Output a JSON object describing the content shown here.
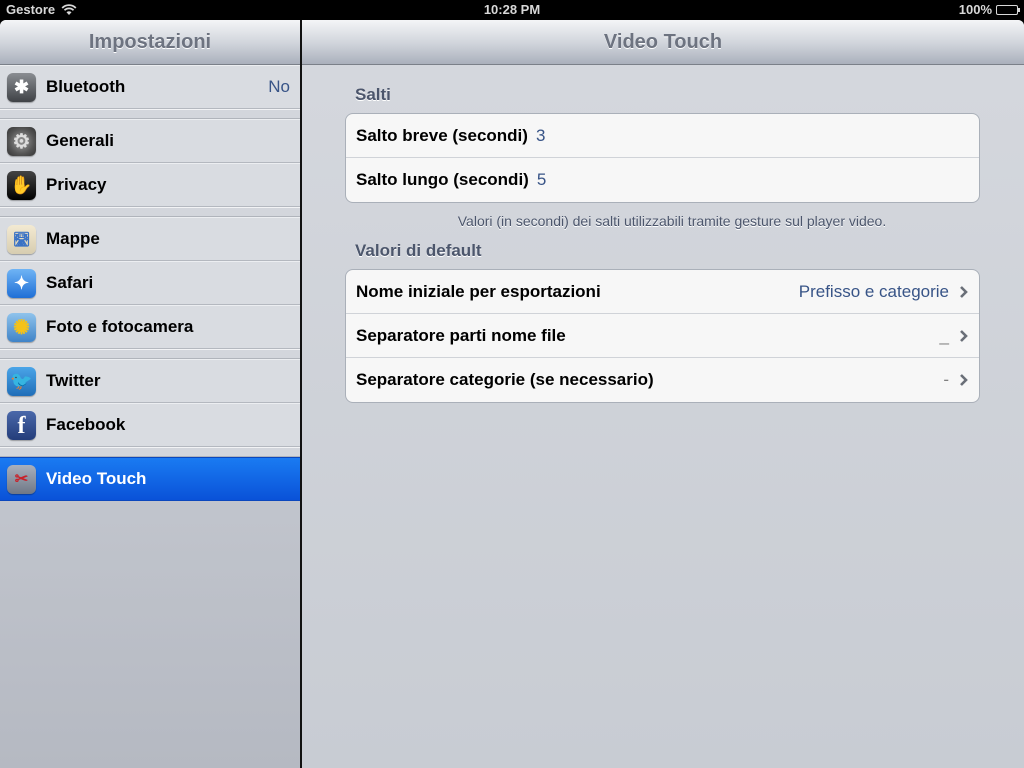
{
  "status_bar": {
    "carrier": "Gestore",
    "time": "10:28 PM",
    "battery": "100%"
  },
  "sidebar": {
    "title": "Impostazioni",
    "groups": [
      [
        {
          "label": "Bluetooth",
          "value": "No",
          "icon": "bluetooth-icon",
          "glyph": "✱"
        }
      ],
      [
        {
          "label": "Generali",
          "value": "",
          "icon": "gear-icon",
          "glyph": "⚙"
        },
        {
          "label": "Privacy",
          "value": "",
          "icon": "hand-icon",
          "glyph": "✋"
        }
      ],
      [
        {
          "label": "Mappe",
          "value": "",
          "icon": "maps-icon",
          "glyph": "🛣"
        },
        {
          "label": "Safari",
          "value": "",
          "icon": "compass-icon",
          "glyph": "✦"
        },
        {
          "label": "Foto e fotocamera",
          "value": "",
          "icon": "sunflower-icon",
          "glyph": "✺"
        }
      ],
      [
        {
          "label": "Twitter",
          "value": "",
          "icon": "twitter-bird-icon",
          "glyph": "🐦"
        },
        {
          "label": "Facebook",
          "value": "",
          "icon": "facebook-icon",
          "glyph": "f"
        }
      ],
      [
        {
          "label": "Video Touch",
          "value": "",
          "icon": "video-camera-scissors-icon",
          "glyph": "✂",
          "selected": true
        }
      ]
    ]
  },
  "main": {
    "title": "Video Touch",
    "sections": [
      {
        "header": "Salti",
        "rows": [
          {
            "label": "Salto breve (secondi)",
            "value": "3"
          },
          {
            "label": "Salto lungo (secondi)",
            "value": "5"
          }
        ],
        "footer": "Valori (in secondi) dei salti utilizzabili tramite gesture sul player video."
      },
      {
        "header": "Valori di default",
        "rows": [
          {
            "label": "Nome iniziale per esportazioni",
            "detail": "Prefisso e categorie"
          },
          {
            "label": "Separatore parti nome file",
            "detail": "_"
          },
          {
            "label": "Separatore categorie (se necessario)",
            "detail": "-"
          }
        ]
      }
    ]
  },
  "colors": {
    "accent_value": "#385487",
    "selected_row": "#1a6fe8"
  }
}
